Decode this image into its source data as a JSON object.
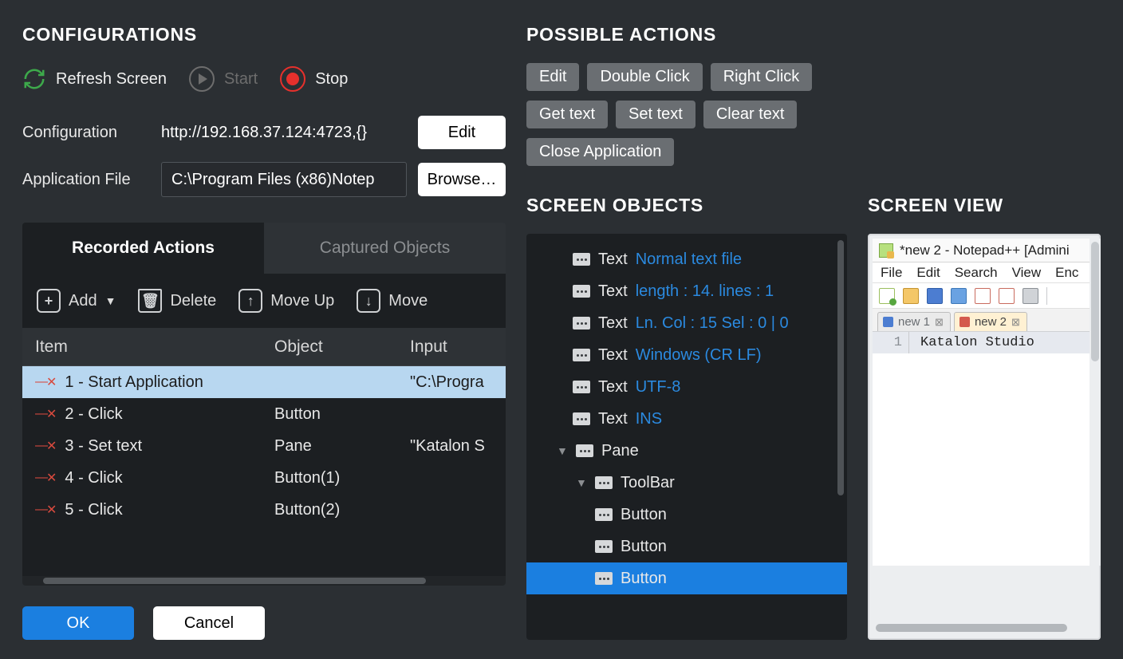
{
  "left": {
    "section_title": "CONFIGURATIONS",
    "refresh": "Refresh Screen",
    "start": "Start",
    "stop": "Stop",
    "config_label": "Configuration",
    "config_value": "http://192.168.37.124:4723,{}",
    "edit_btn": "Edit",
    "appfile_label": "Application File",
    "appfile_value": "C:\\Program Files (x86)Notep",
    "browse_btn": "Browse…",
    "tab_recorded": "Recorded Actions",
    "tab_captured": "Captured Objects",
    "tool_add": "Add",
    "tool_delete": "Delete",
    "tool_moveup": "Move Up",
    "tool_movedown": "Move",
    "col_item": "Item",
    "col_object": "Object",
    "col_input": "Input",
    "rows": [
      {
        "item": "1 - Start Application",
        "object": "",
        "input": "\"C:\\Progra"
      },
      {
        "item": "2 - Click",
        "object": "Button",
        "input": ""
      },
      {
        "item": "3 - Set text",
        "object": "Pane",
        "input": "\"Katalon S"
      },
      {
        "item": "4 - Click",
        "object": "Button(1)",
        "input": ""
      },
      {
        "item": "5 - Click",
        "object": "Button(2)",
        "input": ""
      }
    ],
    "ok": "OK",
    "cancel": "Cancel"
  },
  "right": {
    "actions_title": "POSSIBLE ACTIONS",
    "actions": [
      "Edit",
      "Double Click",
      "Right Click",
      "Get text",
      "Set text",
      "Clear text",
      "Close Application"
    ],
    "screen_objects_title": "SCREEN OBJECTS",
    "tree": [
      {
        "pad": 1,
        "type": "Text",
        "val": "Normal text file"
      },
      {
        "pad": 1,
        "type": "Text",
        "val": "length : 14. lines : 1"
      },
      {
        "pad": 1,
        "type": "Text",
        "val": "Ln.  Col : 15   Sel : 0 | 0"
      },
      {
        "pad": 1,
        "type": "Text",
        "val": "Windows (CR LF)"
      },
      {
        "pad": 1,
        "type": "Text",
        "val": "UTF-8"
      },
      {
        "pad": 1,
        "type": "Text",
        "val": "INS"
      },
      {
        "pad": 2,
        "chev": true,
        "type": "Pane",
        "val": ""
      },
      {
        "pad": 3,
        "chev": true,
        "type": "ToolBar",
        "val": ""
      },
      {
        "pad": 4,
        "type": "Button",
        "val": ""
      },
      {
        "pad": 4,
        "type": "Button",
        "val": ""
      },
      {
        "pad": 4,
        "type": "Button",
        "val": "",
        "hl": true
      }
    ],
    "screen_view_title": "SCREEN VIEW",
    "np": {
      "title": "*new 2 - Notepad++ [Admini",
      "menu": [
        "File",
        "Edit",
        "Search",
        "View",
        "Enc"
      ],
      "tabs": [
        {
          "label": "new 1",
          "active": false
        },
        {
          "label": "new 2",
          "active": true
        }
      ],
      "gutter": "1",
      "line": "Katalon Studio"
    }
  }
}
